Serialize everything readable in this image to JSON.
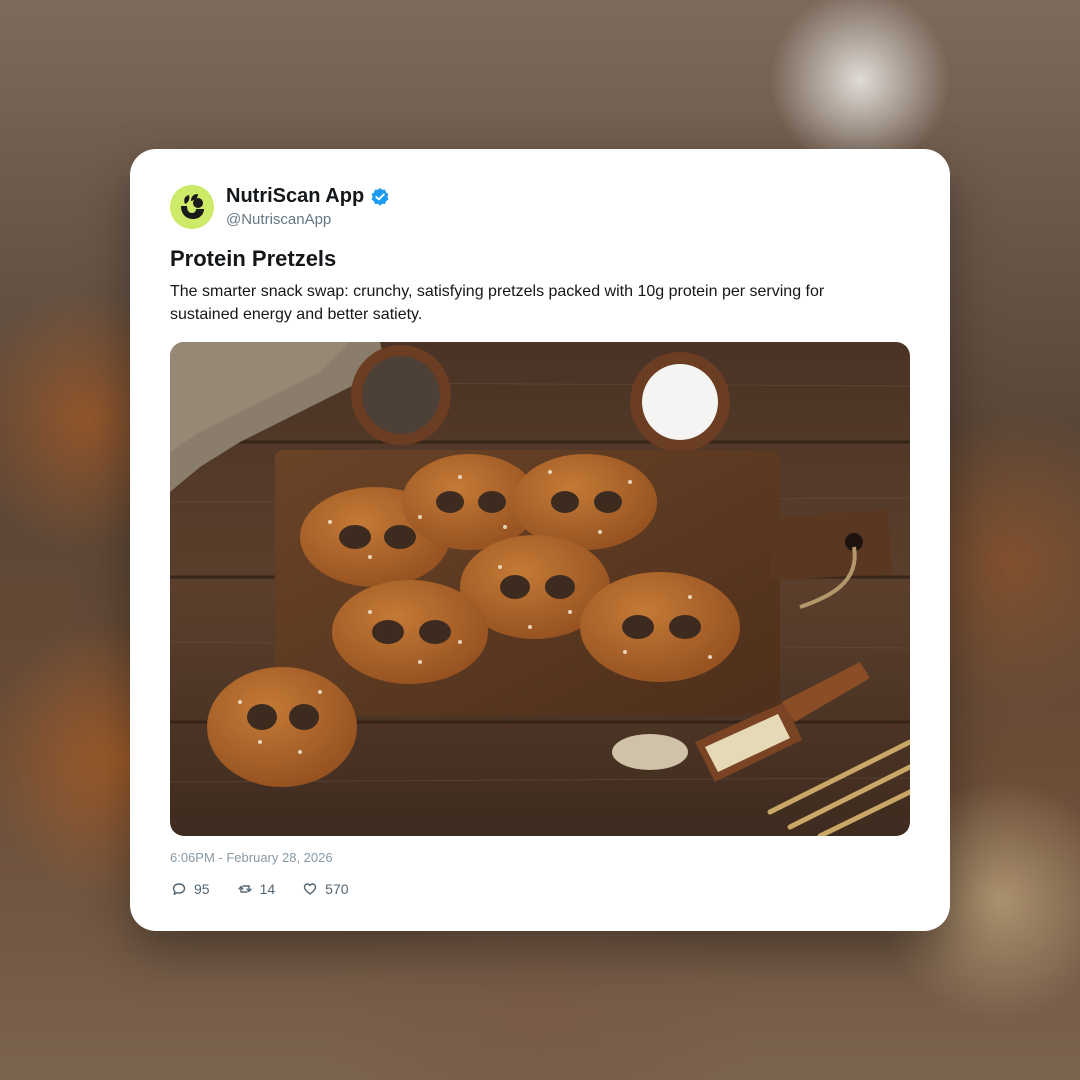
{
  "post": {
    "author": {
      "name": "NutriScan App",
      "handle": "@NutriscanApp",
      "verified": true,
      "avatar_color": "#cdea68",
      "verified_color": "#1d9bf0"
    },
    "title": "Protein Pretzels",
    "text": "The smarter snack swap: crunchy, satisfying pretzels packed with 10g protein per serving for sustained energy and better satiety.",
    "image": "photo of protein pretzels on a wooden board",
    "timestamp": "6:06PM - February 28, 2026",
    "stats": {
      "replies": "95",
      "retweets": "14",
      "likes": "570"
    }
  },
  "icons": {
    "reply": "reply-icon",
    "retweet": "retweet-icon",
    "like": "heart-icon",
    "verified": "verified-badge-icon"
  }
}
